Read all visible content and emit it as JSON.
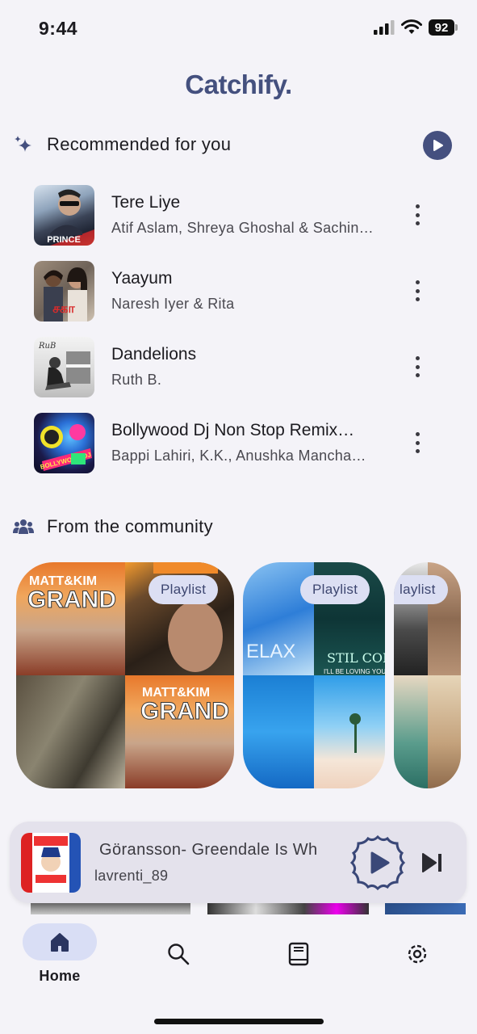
{
  "status_bar": {
    "time": "9:44",
    "battery": "92"
  },
  "app": {
    "title": "Catchify."
  },
  "recommended": {
    "title": "Recommended for you",
    "songs": [
      {
        "title": "Tere Liye",
        "artist": "Atif Aslam, Shreya Ghoshal & Sachin…"
      },
      {
        "title": "Yaayum",
        "artist": "Naresh Iyer & Rita"
      },
      {
        "title": "Dandelions",
        "artist": "Ruth B."
      },
      {
        "title": "Bollywood Dj Non Stop Remix…",
        "artist": "Bappi Lahiri, K.K., Anushka Mancha…"
      }
    ]
  },
  "community": {
    "title": "From the community",
    "playlists": [
      {
        "badge": "Playlist"
      },
      {
        "badge": "Playlist"
      },
      {
        "badge": "laylist"
      }
    ]
  },
  "now_playing": {
    "title": "Göransson- Greendale Is Wh",
    "user": "lavrenti_89"
  },
  "nav": {
    "home": "Home"
  },
  "colors": {
    "accent": "#45507f",
    "brand_title": "#44507e",
    "chip_bg": "#dcdff3"
  },
  "icons": [
    "sparkle-icon",
    "play-icon",
    "more-vert-icon",
    "community-icon",
    "home-icon",
    "search-icon",
    "library-icon",
    "settings-icon",
    "skip-next-icon"
  ]
}
